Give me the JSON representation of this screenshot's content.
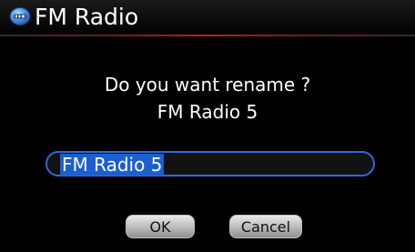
{
  "app": {
    "title": "FM Radio",
    "icon": "fm-radio-icon"
  },
  "dialog": {
    "prompt_line1": "Do you want rename ?",
    "prompt_line2": "FM Radio 5",
    "input_value": "FM Radio 5",
    "ok_label": "OK",
    "cancel_label": "Cancel"
  },
  "colors": {
    "background": "#000000",
    "accent_blue": "#2f6ad8",
    "selection_blue": "#1c5fd0",
    "title_rule_red": "#c02020",
    "button_gray": "#b9b9b9"
  }
}
